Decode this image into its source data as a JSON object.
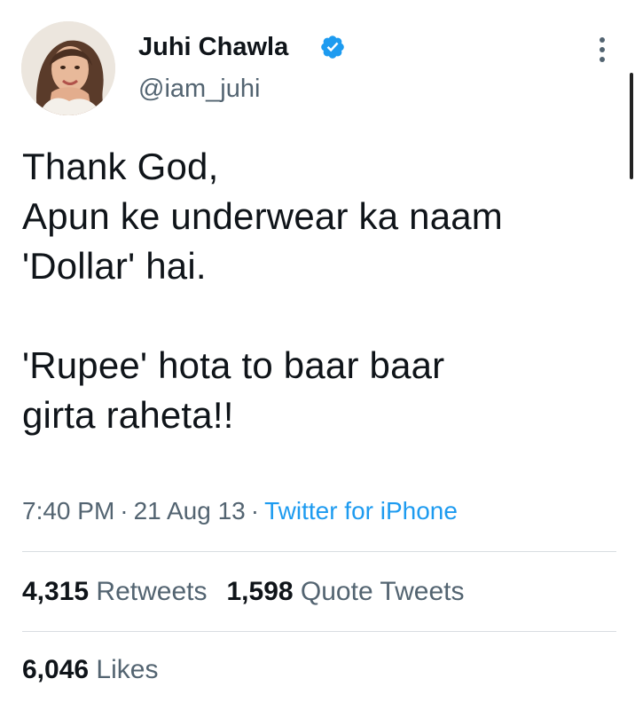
{
  "author": {
    "name": "Juhi Chawla",
    "handle": "@iam_juhi",
    "verified": true,
    "verified_icon": "verified-badge-icon",
    "verified_color": "#1d9bf0"
  },
  "tweet": {
    "lines": [
      "Thank God,",
      "Apun ke underwear ka naam",
      "'Dollar' hai.",
      "",
      "'Rupee' hota to baar baar",
      "girta raheta!!"
    ]
  },
  "meta": {
    "time": "7:40 PM",
    "separator": "·",
    "date": "21 Aug 13",
    "source": "Twitter for iPhone"
  },
  "stats": {
    "retweets_count": "4,315",
    "retweets_label": "Retweets",
    "quotes_count": "1,598",
    "quotes_label": "Quote Tweets",
    "likes_count": "6,046",
    "likes_label": "Likes"
  },
  "colors": {
    "text": "#0f1419",
    "secondary": "#536471",
    "link": "#1d9bf0",
    "divider": "#d9dde1"
  }
}
